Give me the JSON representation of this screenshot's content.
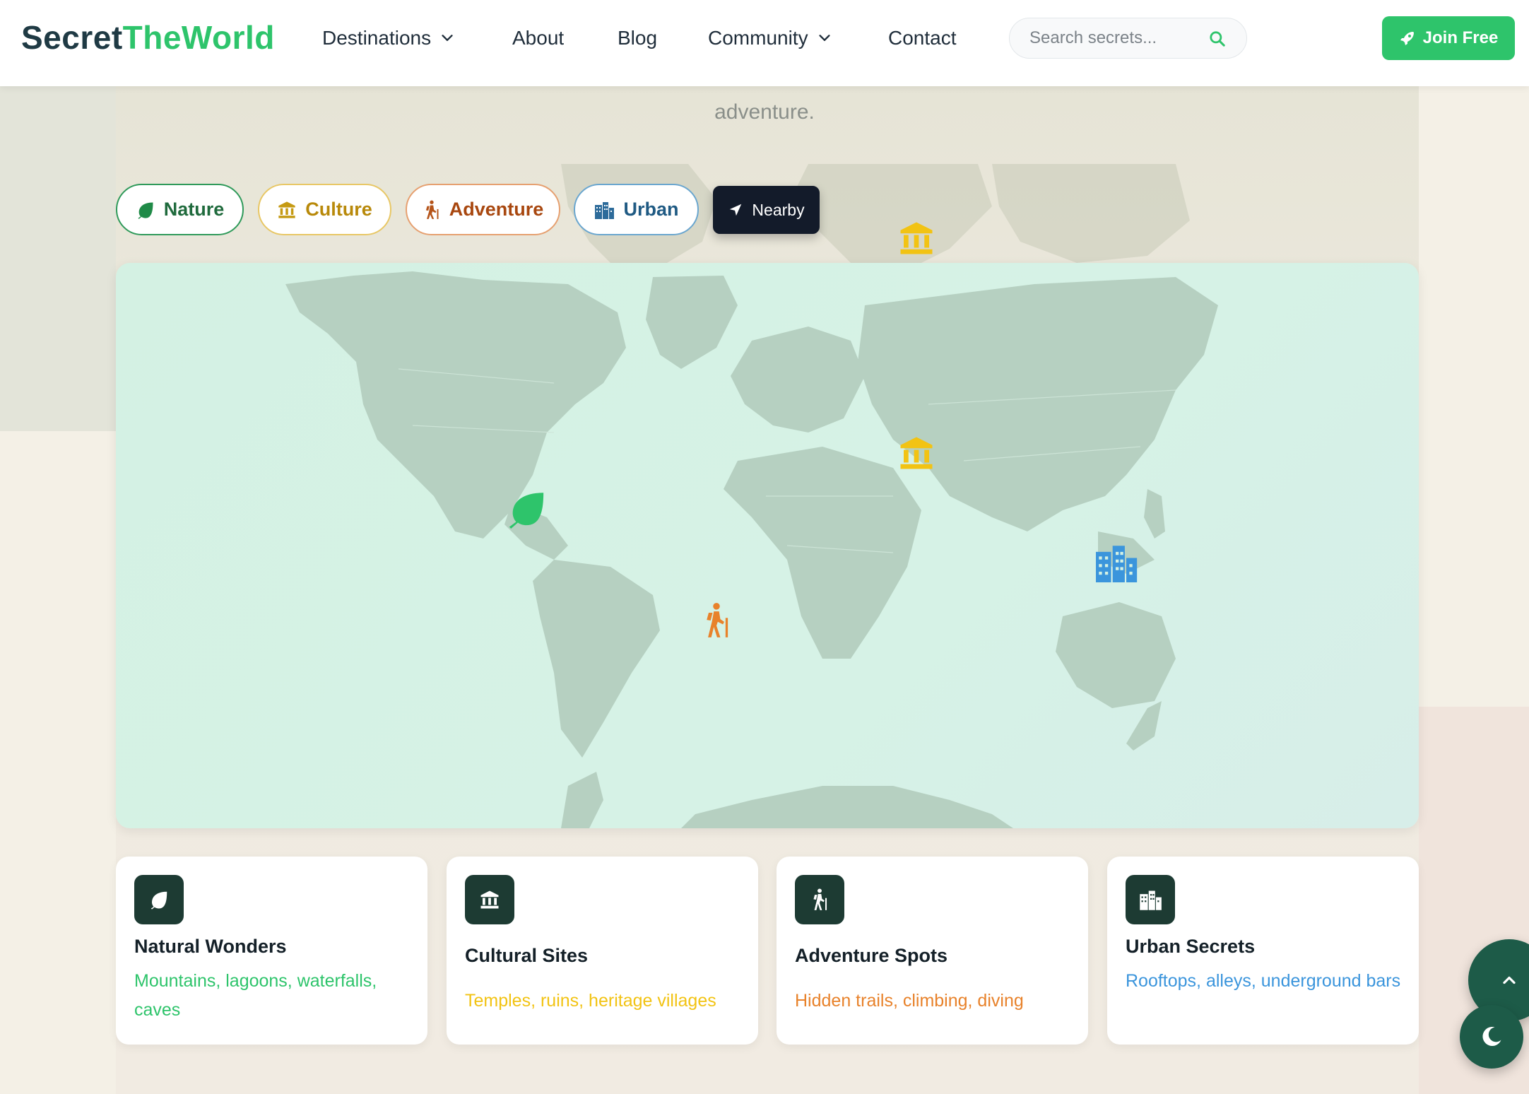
{
  "header": {
    "logo_part1": "Secret",
    "logo_part2": "TheWorld",
    "nav": {
      "destinations": "Destinations",
      "about": "About",
      "blog": "Blog",
      "community": "Community",
      "contact": "Contact"
    },
    "search_placeholder": "Search secrets...",
    "join_label": "Join Free"
  },
  "hero": {
    "tail_text": "adventure."
  },
  "filters": {
    "nature": "Nature",
    "culture": "Culture",
    "adventure": "Adventure",
    "urban": "Urban",
    "nearby": "Nearby"
  },
  "map": {
    "markers": [
      {
        "category": "nature",
        "icon": "leaf-icon",
        "color": "#2ec46b"
      },
      {
        "category": "culture",
        "icon": "landmark-icon",
        "color": "#f2c313"
      },
      {
        "category": "adventure",
        "icon": "hiking-icon",
        "color": "#e8822b"
      },
      {
        "category": "urban",
        "icon": "city-icon",
        "color": "#3b95dc"
      }
    ]
  },
  "cards": [
    {
      "title": "Natural Wonders",
      "desc": "Mountains, lagoons, waterfalls, caves",
      "color": "#2ec46b",
      "icon": "leaf-icon"
    },
    {
      "title": "Cultural Sites",
      "desc": "Temples, ruins, heritage villages",
      "color": "#f2c313",
      "icon": "landmark-icon"
    },
    {
      "title": "Adventure Spots",
      "desc": "Hidden trails, climbing, diving",
      "color": "#e8822b",
      "icon": "hiking-icon"
    },
    {
      "title": "Urban Secrets",
      "desc": "Rooftops, alleys, underground bars",
      "color": "#3b95dc",
      "icon": "city-icon"
    }
  ],
  "colors": {
    "brand_green": "#2ec46b",
    "culture_gold": "#f2c313",
    "adventure_orange": "#e8822b",
    "urban_blue": "#3b95dc",
    "dark_icon_bg": "#1d3b33"
  }
}
